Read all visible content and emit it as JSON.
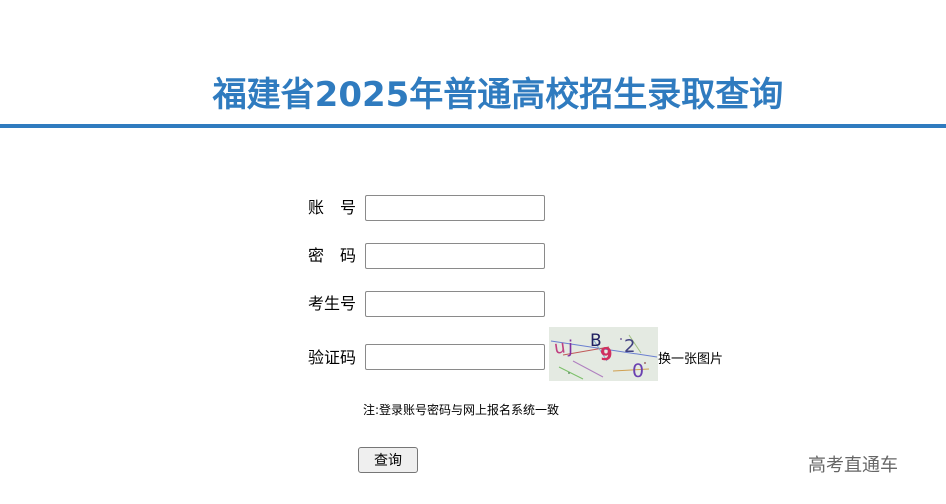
{
  "header": {
    "title": "福建省2025年普通高校招生录取查询",
    "accent_color": "#2f7bbf"
  },
  "form": {
    "account_label": "账号",
    "password_label": "密码",
    "exam_number_label": "考生号",
    "captcha_label": "验证码",
    "account_value": "",
    "password_value": "",
    "exam_number_value": "",
    "captcha_value": "",
    "captcha_image_text": "uj B 9 2 0",
    "captcha_refresh_label": "换一张图片",
    "note": "注:登录账号密码与网上报名系统一致",
    "submit_label": "查询"
  },
  "watermark": {
    "text": "高考直通车"
  }
}
